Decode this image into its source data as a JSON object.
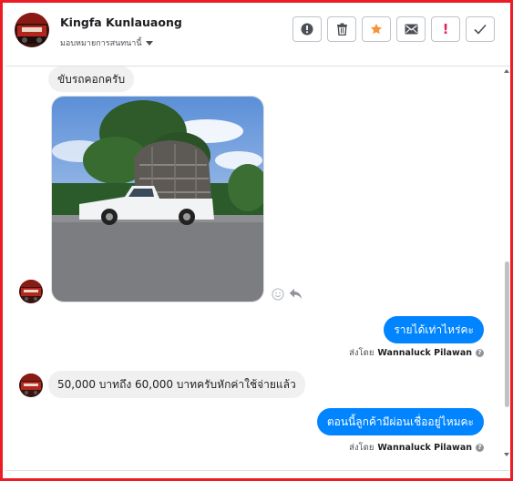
{
  "colors": {
    "frame": "#ec1c24",
    "outgoing_bubble": "#0084ff",
    "incoming_bubble": "#f1f0f0",
    "star": "#f7923a",
    "spam": "#e0245e"
  },
  "header": {
    "contact_name": "Kingfa Kunlauaong",
    "assign_label": "มอบหมายการสนทนานี้",
    "assign_icon": "chevron-down-icon",
    "actions": [
      {
        "name": "info-button",
        "icon": "exclamation-circle-icon"
      },
      {
        "name": "delete-button",
        "icon": "trash-icon"
      },
      {
        "name": "star-button",
        "icon": "star-icon"
      },
      {
        "name": "mark-unread-button",
        "icon": "envelope-icon"
      },
      {
        "name": "spam-button",
        "icon": "exclamation-icon"
      },
      {
        "name": "done-button",
        "icon": "check-icon"
      }
    ]
  },
  "messages": {
    "m1": {
      "direction": "incoming",
      "text": "ขับรถคอกครับ"
    },
    "m2": {
      "direction": "incoming",
      "type": "photo",
      "description_icon": "photo-pickup-truck"
    },
    "m3": {
      "direction": "outgoing",
      "text": "รายได้เท่าไหร่คะ",
      "sent_by_label": "ส่งโดย",
      "sender": "Wannaluck Pilawan"
    },
    "m4": {
      "direction": "incoming",
      "text": "50,000 บาทถึง 60,000 บาทครับหักค่าใช้จ่ายแล้ว"
    },
    "m5": {
      "direction": "outgoing",
      "text": "ตอนนี้ลูกค้ามีผ่อนเชื่ออยู่ไหมคะ",
      "sent_by_label": "ส่งโดย",
      "sender": "Wannaluck Pilawan"
    }
  },
  "help_glyph": "?"
}
